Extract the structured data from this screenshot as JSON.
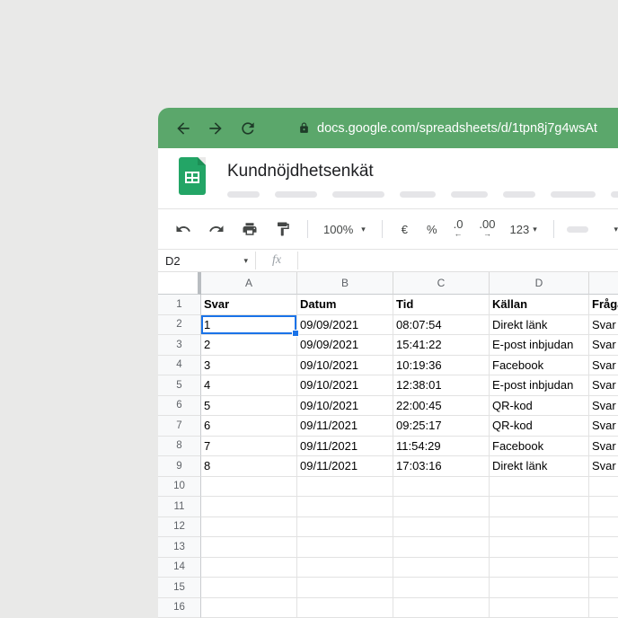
{
  "browser": {
    "url": "docs.google.com/spreadsheets/d/1tpn8j7g4wsAt"
  },
  "document": {
    "title": "Kundnöjdhetsenkät"
  },
  "toolbar": {
    "zoom": "100%",
    "currency": "€",
    "percent": "%",
    "decrease_decimal": ".0",
    "decrease_decimal_arrow": "←",
    "increase_decimal": ".00",
    "increase_decimal_arrow": "→",
    "number_format": "123"
  },
  "formula_bar": {
    "name_box": "D2",
    "fx_label": "fx",
    "input_value": ""
  },
  "grid": {
    "column_headers": [
      "A",
      "B",
      "C",
      "D",
      ""
    ],
    "row_count": 16,
    "header_row": [
      "Svar",
      "Datum",
      "Tid",
      "Källan",
      "Fråga"
    ],
    "data_rows": [
      [
        "1",
        "09/09/2021",
        "08:07:54",
        "Direkt länk",
        "Svar"
      ],
      [
        "2",
        "09/09/2021",
        "15:41:22",
        "E-post inbjudan",
        "Svar"
      ],
      [
        "3",
        "09/10/2021",
        "10:19:36",
        "Facebook",
        "Svar"
      ],
      [
        "4",
        "09/10/2021",
        "12:38:01",
        "E-post inbjudan",
        "Svar"
      ],
      [
        "5",
        "09/10/2021",
        "22:00:45",
        "QR-kod",
        "Svar"
      ],
      [
        "6",
        "09/11/2021",
        "09:25:17",
        "QR-kod",
        "Svar"
      ],
      [
        "7",
        "09/11/2021",
        "11:54:29",
        "Facebook",
        "Svar"
      ],
      [
        "8",
        "09/11/2021",
        "17:03:16",
        "Direkt länk",
        "Svar"
      ]
    ],
    "selected_cell": "A2"
  },
  "icons": {
    "caret_down": "▾"
  },
  "colors": {
    "chrome_green": "#5BA76B",
    "sheets_green": "#23A566",
    "selection_blue": "#1A73E8",
    "background": "#E9E9E8"
  }
}
